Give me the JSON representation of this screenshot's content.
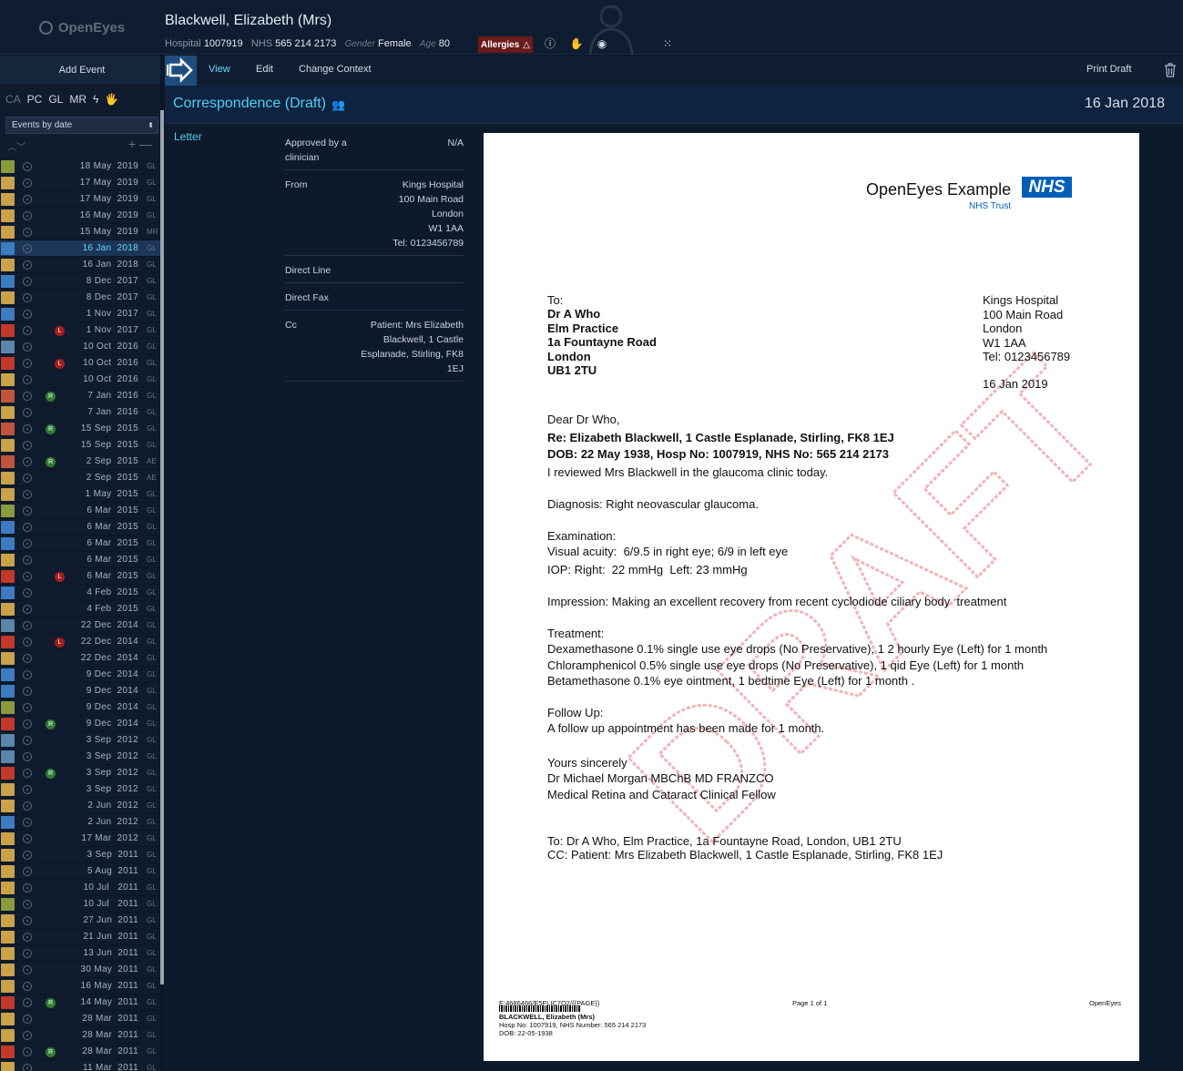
{
  "app": {
    "logo": "OpenEyes"
  },
  "patient": {
    "name": "Blackwell, Elizabeth (Mrs)",
    "hospital_label": "Hospital",
    "hospital_no": "1007919",
    "nhs_label": "NHS",
    "nhs_no": "565 214 2173",
    "gender_label": "Gender",
    "gender": "Female",
    "age_label": "Age",
    "age": "80",
    "allergies": "Allergies"
  },
  "sidebar": {
    "add_event": "Add Event",
    "filters": [
      "CA",
      "PC",
      "GL",
      "MR",
      "ϟ",
      "🖐"
    ],
    "sort_select": "Events by date",
    "events": [
      {
        "date": "18 May  2019",
        "sp": "GL",
        "icon": "#8a9a3c"
      },
      {
        "date": "17 May  2019",
        "sp": "GL",
        "icon": "#c9a24a"
      },
      {
        "date": "17 May  2019",
        "sp": "GL",
        "icon": "#c9a24a"
      },
      {
        "date": "16 May  2019",
        "sp": "GL",
        "icon": "#c9a24a"
      },
      {
        "date": "15 May  2019",
        "sp": "MR",
        "icon": "#c9a24a"
      },
      {
        "date": "16 Jan  2018",
        "sp": "GL",
        "icon": "#3d7cc0",
        "sel": true
      },
      {
        "date": "16 Jan  2018",
        "sp": "GL",
        "icon": "#c9a24a"
      },
      {
        "date": "8 Dec  2017",
        "sp": "GL",
        "icon": "#3d7cc0"
      },
      {
        "date": "8 Dec  2017",
        "sp": "GL",
        "icon": "#c9a24a"
      },
      {
        "date": "1 Nov  2017",
        "sp": "GL",
        "icon": "#3d7cc0"
      },
      {
        "date": "1 Nov  2017",
        "sp": "GL",
        "icon": "#c0392b",
        "badge": "L"
      },
      {
        "date": "10 Oct  2016",
        "sp": "GL",
        "icon": "#5b86a8"
      },
      {
        "date": "10 Oct  2016",
        "sp": "GL",
        "icon": "#c0392b",
        "badge": "L"
      },
      {
        "date": "10 Oct  2016",
        "sp": "GL",
        "icon": "#c9a24a"
      },
      {
        "date": "7 Jan  2016",
        "sp": "GL",
        "icon": "#c0553b",
        "badge": "R"
      },
      {
        "date": "7 Jan  2016",
        "sp": "GL",
        "icon": "#c9a24a"
      },
      {
        "date": "15 Sep  2015",
        "sp": "GL",
        "icon": "#c0553b",
        "badge": "R"
      },
      {
        "date": "15 Sep  2015",
        "sp": "GL",
        "icon": "#c9a24a"
      },
      {
        "date": "2 Sep  2015",
        "sp": "AE",
        "icon": "#c0553b",
        "badge": "R"
      },
      {
        "date": "2 Sep  2015",
        "sp": "AE",
        "icon": "#c9a24a"
      },
      {
        "date": "1 May  2015",
        "sp": "GL",
        "icon": "#c9a24a"
      },
      {
        "date": "6 Mar  2015",
        "sp": "GL",
        "icon": "#8a9a3c"
      },
      {
        "date": "6 Mar  2015",
        "sp": "GL",
        "icon": "#3d7cc0"
      },
      {
        "date": "6 Mar  2015",
        "sp": "GL",
        "icon": "#3d7cc0"
      },
      {
        "date": "6 Mar  2015",
        "sp": "GL",
        "icon": "#c9a24a"
      },
      {
        "date": "6 Mar  2015",
        "sp": "GL",
        "icon": "#c0392b",
        "badge": "L"
      },
      {
        "date": "4 Feb  2015",
        "sp": "GL",
        "icon": "#3d7cc0"
      },
      {
        "date": "4 Feb  2015",
        "sp": "GL",
        "icon": "#c9a24a"
      },
      {
        "date": "22 Dec  2014",
        "sp": "GL",
        "icon": "#5b86a8"
      },
      {
        "date": "22 Dec  2014",
        "sp": "GL",
        "icon": "#c0392b",
        "badge": "L"
      },
      {
        "date": "22 Dec  2014",
        "sp": "GL",
        "icon": "#c9a24a"
      },
      {
        "date": "9 Dec  2014",
        "sp": "GL",
        "icon": "#3d7cc0"
      },
      {
        "date": "9 Dec  2014",
        "sp": "GL",
        "icon": "#3d7cc0"
      },
      {
        "date": "9 Dec  2014",
        "sp": "GL",
        "icon": "#8a9a3c"
      },
      {
        "date": "9 Dec  2014",
        "sp": "GL",
        "icon": "#c0392b",
        "badge": "R"
      },
      {
        "date": "3 Sep  2012",
        "sp": "GL",
        "icon": "#5b86a8"
      },
      {
        "date": "3 Sep  2012",
        "sp": "GL",
        "icon": "#5b86a8"
      },
      {
        "date": "3 Sep  2012",
        "sp": "GL",
        "icon": "#c0392b",
        "badge": "R"
      },
      {
        "date": "3 Sep  2012",
        "sp": "GL",
        "icon": "#c9a24a"
      },
      {
        "date": "2 Jun  2012",
        "sp": "GL",
        "icon": "#c9a24a"
      },
      {
        "date": "2 Jun  2012",
        "sp": "GL",
        "icon": "#3d7cc0"
      },
      {
        "date": "17 Mar  2012",
        "sp": "GL",
        "icon": "#c9a24a"
      },
      {
        "date": "3 Sep  2011",
        "sp": "GL",
        "icon": "#c9a24a"
      },
      {
        "date": "5 Aug  2011",
        "sp": "GL",
        "icon": "#c9a24a"
      },
      {
        "date": "10 Jul   2011",
        "sp": "GL",
        "icon": "#c9a24a"
      },
      {
        "date": "10 Jul   2011",
        "sp": "GL",
        "icon": "#8a9a3c"
      },
      {
        "date": "27 Jun  2011",
        "sp": "GL",
        "icon": "#c9a24a"
      },
      {
        "date": "21 Jun  2011",
        "sp": "GL",
        "icon": "#c9a24a"
      },
      {
        "date": "13 Jun  2011",
        "sp": "GL",
        "icon": "#c9a24a"
      },
      {
        "date": "30 May  2011",
        "sp": "GL",
        "icon": "#c9a24a"
      },
      {
        "date": "16 May  2011",
        "sp": "GL",
        "icon": "#c9a24a"
      },
      {
        "date": "14 May  2011",
        "sp": "GL",
        "icon": "#c0392b",
        "badge": "R"
      },
      {
        "date": "28 Mar  2011",
        "sp": "GL",
        "icon": "#c9a24a"
      },
      {
        "date": "28 Mar  2011",
        "sp": "GL",
        "icon": "#c9a24a"
      },
      {
        "date": "28 Mar  2011",
        "sp": "GL",
        "icon": "#c0392b",
        "badge": "R"
      },
      {
        "date": "11 Mar  2011",
        "sp": "GL",
        "icon": "#c9a24a"
      }
    ]
  },
  "tabs": {
    "view": "View",
    "edit": "Edit",
    "change_context": "Change Context",
    "print_draft": "Print Draft"
  },
  "event": {
    "title": "Correspondence (Draft)",
    "date": "16 Jan 2018",
    "section": "Letter",
    "meta": [
      {
        "k": "Approved by a clinician",
        "v": "N/A"
      },
      {
        "k": "From",
        "v": "Kings Hospital\n100 Main Road\nLondon\nW1 1AA\nTel: 0123456789"
      },
      {
        "k": "Direct Line",
        "v": ""
      },
      {
        "k": "Direct Fax",
        "v": ""
      },
      {
        "k": "Cc",
        "v": "Patient: Mrs Elizabeth\nBlackwell, 1 Castle\nEsplanade, Stirling, FK8 1EJ"
      }
    ]
  },
  "letter": {
    "org": "OpenEyes Example",
    "nhs": "NHS",
    "trust": "NHS Trust",
    "to_label": "To:",
    "to_lines": [
      "Dr A Who",
      "Elm Practice",
      "1a Fountayne Road",
      "London",
      "UB1 2TU"
    ],
    "from_lines": [
      "Kings Hospital",
      "100 Main Road",
      "London",
      "W1 1AA",
      "Tel: 0123456789"
    ],
    "date": "16 Jan 2019",
    "salutation": "Dear Dr Who,",
    "re": "Re: Elizabeth Blackwell, 1 Castle Esplanade, Stirling, FK8 1EJ",
    "dob": "DOB: 22 May 1938, Hosp No: 1007919, NHS No: 565 214 2173",
    "intro": "I reviewed Mrs Blackwell in the glaucoma clinic today.",
    "diagnosis": "Diagnosis: Right neovascular glaucoma.",
    "exam_h": "Examination:",
    "exam_va": "Visual acuity:  6/9.5 in right eye; 6/9 in left eye",
    "exam_iop": "IOP: Right:  22 mmHg  Left: 23 mmHg",
    "impression": "Impression: Making an excellent recovery from recent cyclodiode ciliary body  treatment",
    "treat_h": "Treatment:",
    "treat_1": "Dexamethasone 0.1% single use eye drops (No Preservative), 1 2 hourly Eye (Left) for 1 month",
    "treat_2": "Chloramphenicol 0.5% single use eye drops (No Preservative), 1 qid Eye (Left) for 1 month",
    "treat_3": "Betamethasone 0.1% eye ointment, 1 bedtime Eye (Left) for 1 month .",
    "follow_h": "Follow Up:",
    "follow": "A follow up appointment has been made for 1 month.",
    "closing": "Yours sincerely",
    "signer": "Dr Michael Morgan MBChB MD FRANZCO",
    "signer_role": "Medical Retina and Cataract Clinical Fellow",
    "to_footer": "To: Dr A Who, Elm Practice, 1a Fountayne Road, London, UB1 2TU",
    "cc_footer": "CC: Patient: Mrs Elizabeth Blackwell, 1 Castle Esplanade, Stirling, FK8 1EJ",
    "watermark": "DRAFT",
    "foot_code": "E:4686466/E5FLIC7O2/{{PAGE}}",
    "foot_name": "BLACKWELL, Elizabeth (Mrs)",
    "foot_hosp": "Hosp No: 1007919, NHS Number: 565 214 2173",
    "foot_dob": "DOB: 22-05-1938",
    "foot_page": "Page 1 of 1",
    "foot_app": "OpenEyes"
  }
}
